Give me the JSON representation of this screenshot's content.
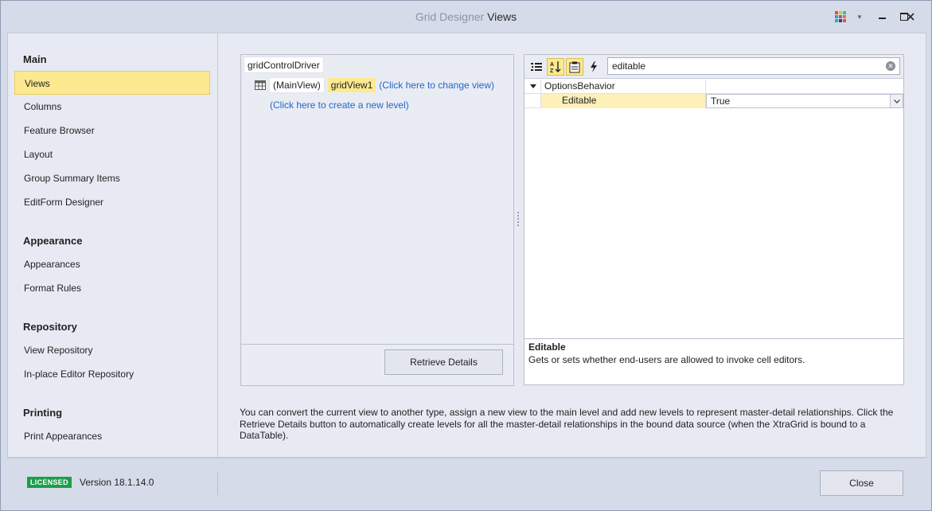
{
  "window": {
    "title_prefix": "Grid Designer",
    "title_main": "Views"
  },
  "sidebar": {
    "groups": [
      {
        "label": "Main",
        "items": [
          "Views",
          "Columns",
          "Feature Browser",
          "Layout",
          "Group Summary Items",
          "EditForm Designer"
        ]
      },
      {
        "label": "Appearance",
        "items": [
          "Appearances",
          "Format Rules"
        ]
      },
      {
        "label": "Repository",
        "items": [
          "View Repository",
          "In-place Editor Repository"
        ]
      },
      {
        "label": "Printing",
        "items": [
          "Print Appearances"
        ]
      }
    ],
    "active_item": "Views"
  },
  "levels": {
    "root": "gridControlDriver",
    "main_view_label": "(MainView)",
    "view_name": "gridView1",
    "change_view_link": "(Click here to change view)",
    "new_level_link": "(Click here to create a new level)",
    "retrieve_button": "Retrieve Details"
  },
  "property_grid": {
    "search_value": "editable",
    "category": "OptionsBehavior",
    "property_name": "Editable",
    "property_value": "True",
    "description_title": "Editable",
    "description_text": "Gets or sets whether end-users are allowed to invoke cell editors."
  },
  "help_text": "You can convert the current view to another type, assign a new view to the main level and add new levels to represent master-detail relationships. Click the Retrieve Details button to automatically create levels for all the master-detail relationships in the bound data source (when the XtraGrid is bound to a DataTable).",
  "footer": {
    "badge": "LICENSED",
    "version": "Version 18.1.14.0",
    "close_button": "Close"
  },
  "icons": {
    "palette": "palette-icon",
    "minimize": "minimize-icon",
    "maximize": "maximize-icon",
    "close": "close-icon",
    "categorized": "categorized-icon",
    "alphabetical": "alphabetical-sort-icon",
    "properties": "properties-icon",
    "events": "lightning-icon",
    "clear": "clear-search-icon",
    "grid_view": "grid-view-icon"
  },
  "colors": {
    "active_highlight": "#fde98f",
    "link": "#2366cc",
    "licensed_badge": "#1b9f4a"
  }
}
